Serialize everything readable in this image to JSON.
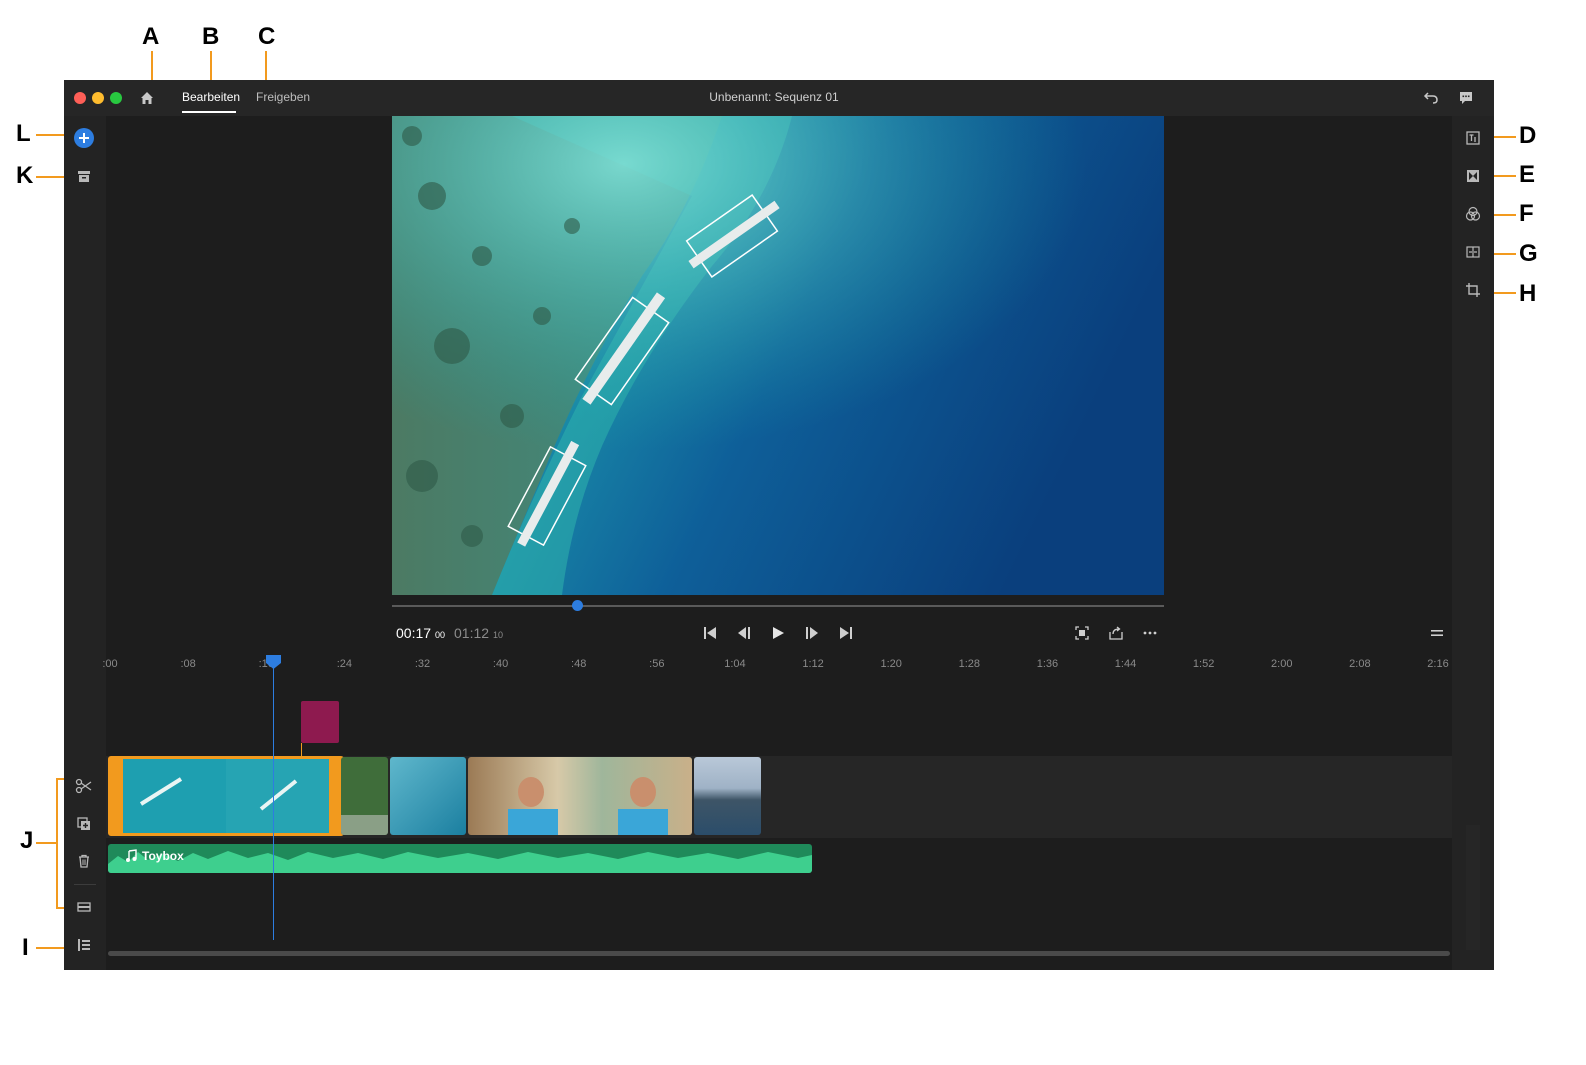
{
  "callouts": {
    "a": "A",
    "b": "B",
    "c": "C",
    "d": "D",
    "e": "E",
    "f": "F",
    "g": "G",
    "h": "H",
    "i": "I",
    "j": "J",
    "k": "K",
    "l": "L"
  },
  "window": {
    "title": "Unbenannt: Sequenz 01",
    "tabs": [
      {
        "label": "Bearbeiten",
        "active": true
      },
      {
        "label": "Freigeben",
        "active": false
      }
    ]
  },
  "left_toolbar": {
    "top": [
      "add-media-icon",
      "project-panel-icon"
    ],
    "timeline_tools": [
      "split-icon",
      "duplicate-icon",
      "delete-icon",
      "track-height-icon",
      "timeline-view-icon"
    ]
  },
  "right_toolbar": [
    "titles-icon",
    "transitions-icon",
    "color-icon",
    "speed-icon",
    "crop-icon"
  ],
  "playback": {
    "current_main": "00:17",
    "current_frames": "00",
    "duration_main": "01:12",
    "duration_frames": "10",
    "scrub_progress": 0.24
  },
  "ruler": {
    "ticks": [
      ":00",
      ":08",
      ":16",
      ":24",
      ":32",
      ":40",
      ":48",
      ":56",
      "1:04",
      "1:12",
      "1:20",
      "1:28",
      "1:36",
      "1:44",
      "1:52",
      "2:00",
      "2:08",
      "2:16"
    ]
  },
  "audio": {
    "title": "Toybox"
  },
  "colors": {
    "accent_blue": "#2d7de0",
    "selection_orange": "#f29a1e",
    "audio_green": "#1f8a5a",
    "marker_magenta": "#8e1a4f",
    "app_bg": "#1d1d1d"
  }
}
